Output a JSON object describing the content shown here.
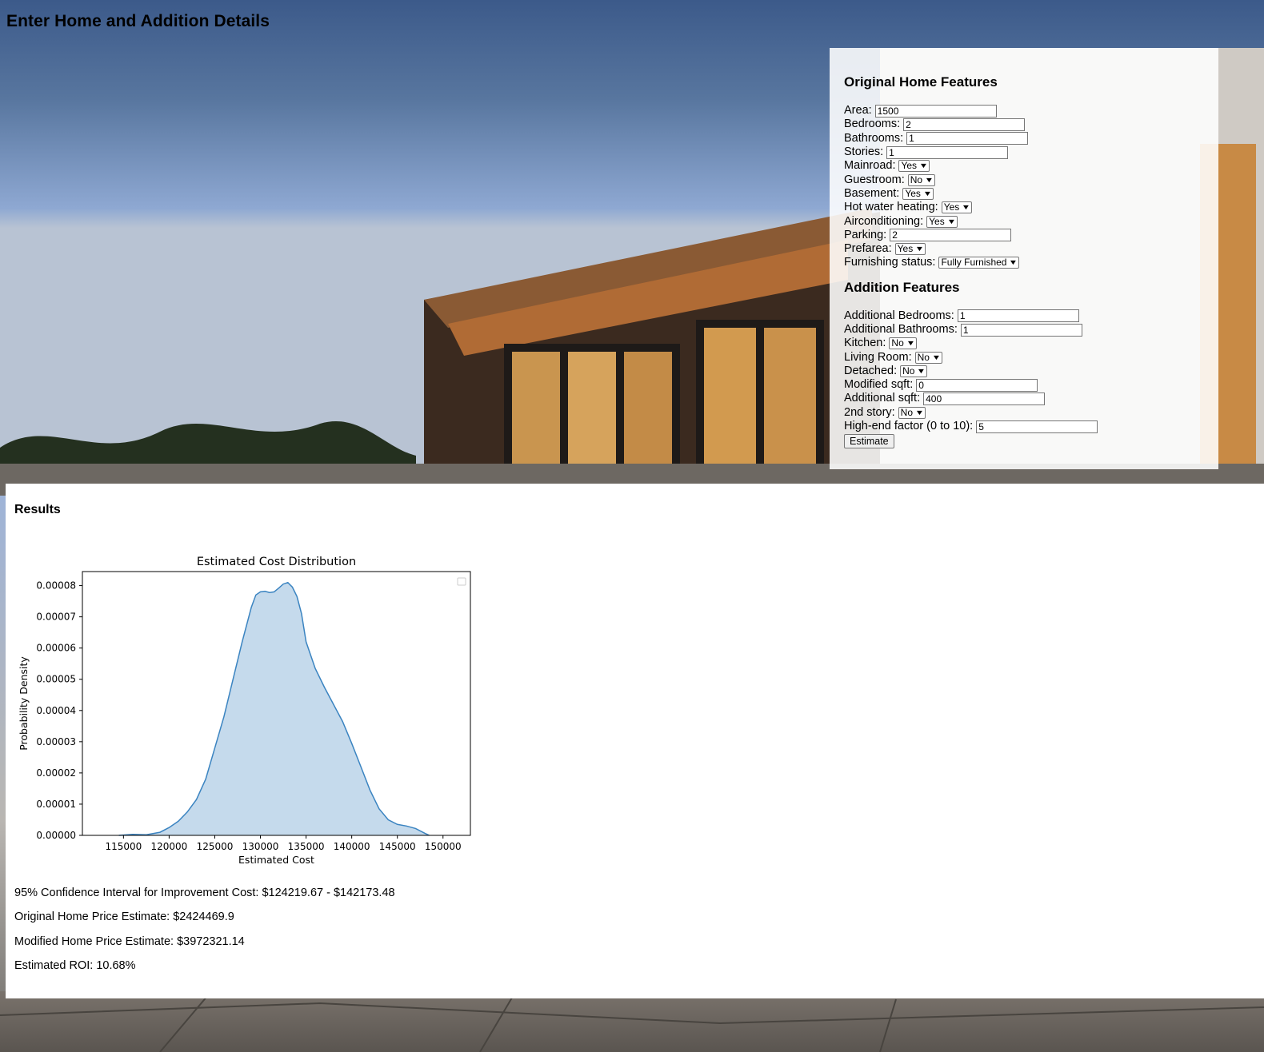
{
  "page": {
    "title": "Enter Home and Addition Details"
  },
  "original": {
    "heading": "Original Home Features",
    "fields": [
      {
        "label": "Area:",
        "type": "input",
        "value": "1500"
      },
      {
        "label": "Bedrooms:",
        "type": "input",
        "value": "2"
      },
      {
        "label": "Bathrooms:",
        "type": "input",
        "value": "1"
      },
      {
        "label": "Stories:",
        "type": "input",
        "value": "1"
      },
      {
        "label": "Mainroad:",
        "type": "select",
        "value": "Yes"
      },
      {
        "label": "Guestroom:",
        "type": "select",
        "value": "No"
      },
      {
        "label": "Basement:",
        "type": "select",
        "value": "Yes"
      },
      {
        "label": "Hot water heating:",
        "type": "select",
        "value": "Yes"
      },
      {
        "label": "Airconditioning:",
        "type": "select",
        "value": "Yes"
      },
      {
        "label": "Parking:",
        "type": "input",
        "value": "2"
      },
      {
        "label": "Prefarea:",
        "type": "select",
        "value": "Yes"
      },
      {
        "label": "Furnishing status:",
        "type": "select",
        "value": "Fully Furnished"
      }
    ]
  },
  "addition": {
    "heading": "Addition Features",
    "fields": [
      {
        "label": "Additional Bedrooms:",
        "type": "input",
        "value": "1"
      },
      {
        "label": "Additional Bathrooms:",
        "type": "input",
        "value": "1"
      },
      {
        "label": "Kitchen:",
        "type": "select",
        "value": "No"
      },
      {
        "label": "Living Room:",
        "type": "select",
        "value": "No"
      },
      {
        "label": "Detached:",
        "type": "select",
        "value": "No"
      },
      {
        "label": "Modified sqft:",
        "type": "input",
        "value": "0"
      },
      {
        "label": "Additional sqft:",
        "type": "input",
        "value": "400"
      },
      {
        "label": "2nd story:",
        "type": "select",
        "value": "No"
      },
      {
        "label": "High-end factor (0 to 10):",
        "type": "input",
        "value": "5"
      }
    ],
    "estimate_label": "Estimate"
  },
  "results": {
    "heading": "Results",
    "lines": [
      "95% Confidence Interval for Improvement Cost: $124219.67 - $142173.48",
      "Original Home Price Estimate: $2424469.9",
      "Modified Home Price Estimate: $3972321.14",
      "Estimated ROI: 10.68%"
    ]
  },
  "chart_data": {
    "type": "area",
    "title": "Estimated Cost Distribution",
    "xlabel": "Estimated Cost",
    "ylabel": "Probability Density",
    "xlim": [
      110500,
      153000
    ],
    "ylim": [
      0,
      8.45e-05
    ],
    "xticks": [
      115000,
      120000,
      125000,
      130000,
      135000,
      140000,
      145000,
      150000
    ],
    "yticks": [
      0.0,
      1e-05,
      2e-05,
      3e-05,
      4e-05,
      5e-05,
      6e-05,
      7e-05,
      8e-05
    ],
    "ytick_labels": [
      "0.00000",
      "0.00001",
      "0.00002",
      "0.00003",
      "0.00004",
      "0.00005",
      "0.00006",
      "0.00007",
      "0.00008"
    ],
    "legend": "top-right (empty)",
    "color": "#3b84c1",
    "fill_color": "#c5daec",
    "x": [
      114500,
      116000,
      117500,
      119000,
      120000,
      121000,
      122000,
      123000,
      124000,
      125000,
      126000,
      127000,
      128000,
      129000,
      129500,
      130000,
      130500,
      131000,
      131500,
      132000,
      132500,
      133000,
      133500,
      134000,
      134500,
      135000,
      136000,
      137000,
      138000,
      139000,
      140000,
      141000,
      142000,
      143000,
      144000,
      145000,
      146000,
      147000,
      148000,
      148500
    ],
    "y": [
      0.0,
      3e-07,
      2e-07,
      1e-06,
      2.5e-06,
      4.5e-06,
      7.5e-06,
      1.15e-05,
      1.8e-05,
      2.8e-05,
      3.8e-05,
      5e-05,
      6.2e-05,
      7.3e-05,
      7.7e-05,
      7.8e-05,
      7.82e-05,
      7.78e-05,
      7.8e-05,
      7.92e-05,
      8.05e-05,
      8.1e-05,
      7.95e-05,
      7.65e-05,
      7.1e-05,
      6.2e-05,
      5.35e-05,
      4.75e-05,
      4.2e-05,
      3.65e-05,
      2.95e-05,
      2.2e-05,
      1.45e-05,
      8.5e-06,
      5e-06,
      3.5e-06,
      3e-06,
      2.2e-06,
      7e-07,
      0.0
    ]
  }
}
